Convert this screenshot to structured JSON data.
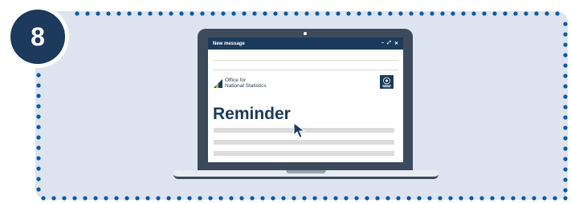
{
  "step": {
    "number": "8"
  },
  "email_window": {
    "title": "New message",
    "controls": [
      "–",
      "⤢",
      "✕"
    ]
  },
  "sender_logo": {
    "line1": "Office for",
    "line2": "National Statistics"
  },
  "crest_icon": "uk-government-crest-icon",
  "email_body": {
    "heading": "Reminder"
  },
  "colors": {
    "navy": "#1b3a5c",
    "panel_bg": "#dde4ef",
    "dot_border": "#0a5aa8",
    "laptop_frame": "#3d4a5c"
  }
}
